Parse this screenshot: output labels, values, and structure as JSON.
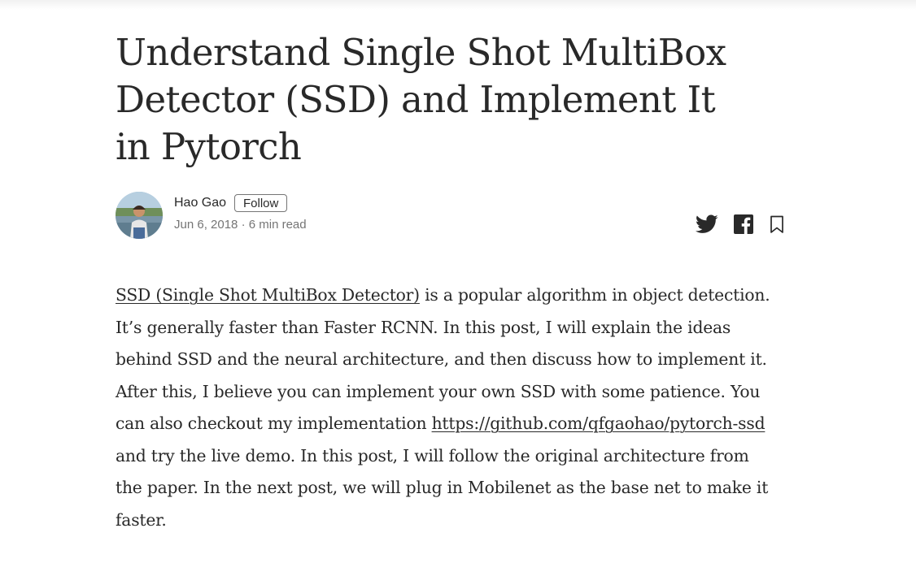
{
  "article": {
    "title": "Understand Single Shot MultiBox Detector (SSD) and Implement It in Pytorch",
    "author": {
      "name": "Hao Gao",
      "follow_label": "Follow",
      "date": "Jun 6, 2018",
      "separator": " · ",
      "read_time": "6 min read"
    },
    "share_icons": [
      "twitter-icon",
      "facebook-icon",
      "bookmark-icon"
    ],
    "paragraph": {
      "link1_text": "SSD (Single Shot MultiBox Detector)",
      "text1": " is a popular algorithm in object detection. It’s generally faster than Faster RCNN. In this post, I will explain the ideas behind SSD and the neural architecture, and then discuss how to implement it. After this, I believe you can implement your own SSD with some patience. You can also checkout my implementation ",
      "link2_text": "https://github.com/qfgaohao/pytorch-ssd",
      "text2": " and try the live demo. In this post, I will follow the original architecture from the paper. In the next post, we will plug in Mobilenet as the base net to make it faster."
    }
  },
  "colors": {
    "text": "#292929",
    "muted": "#757575",
    "background": "#ffffff"
  }
}
